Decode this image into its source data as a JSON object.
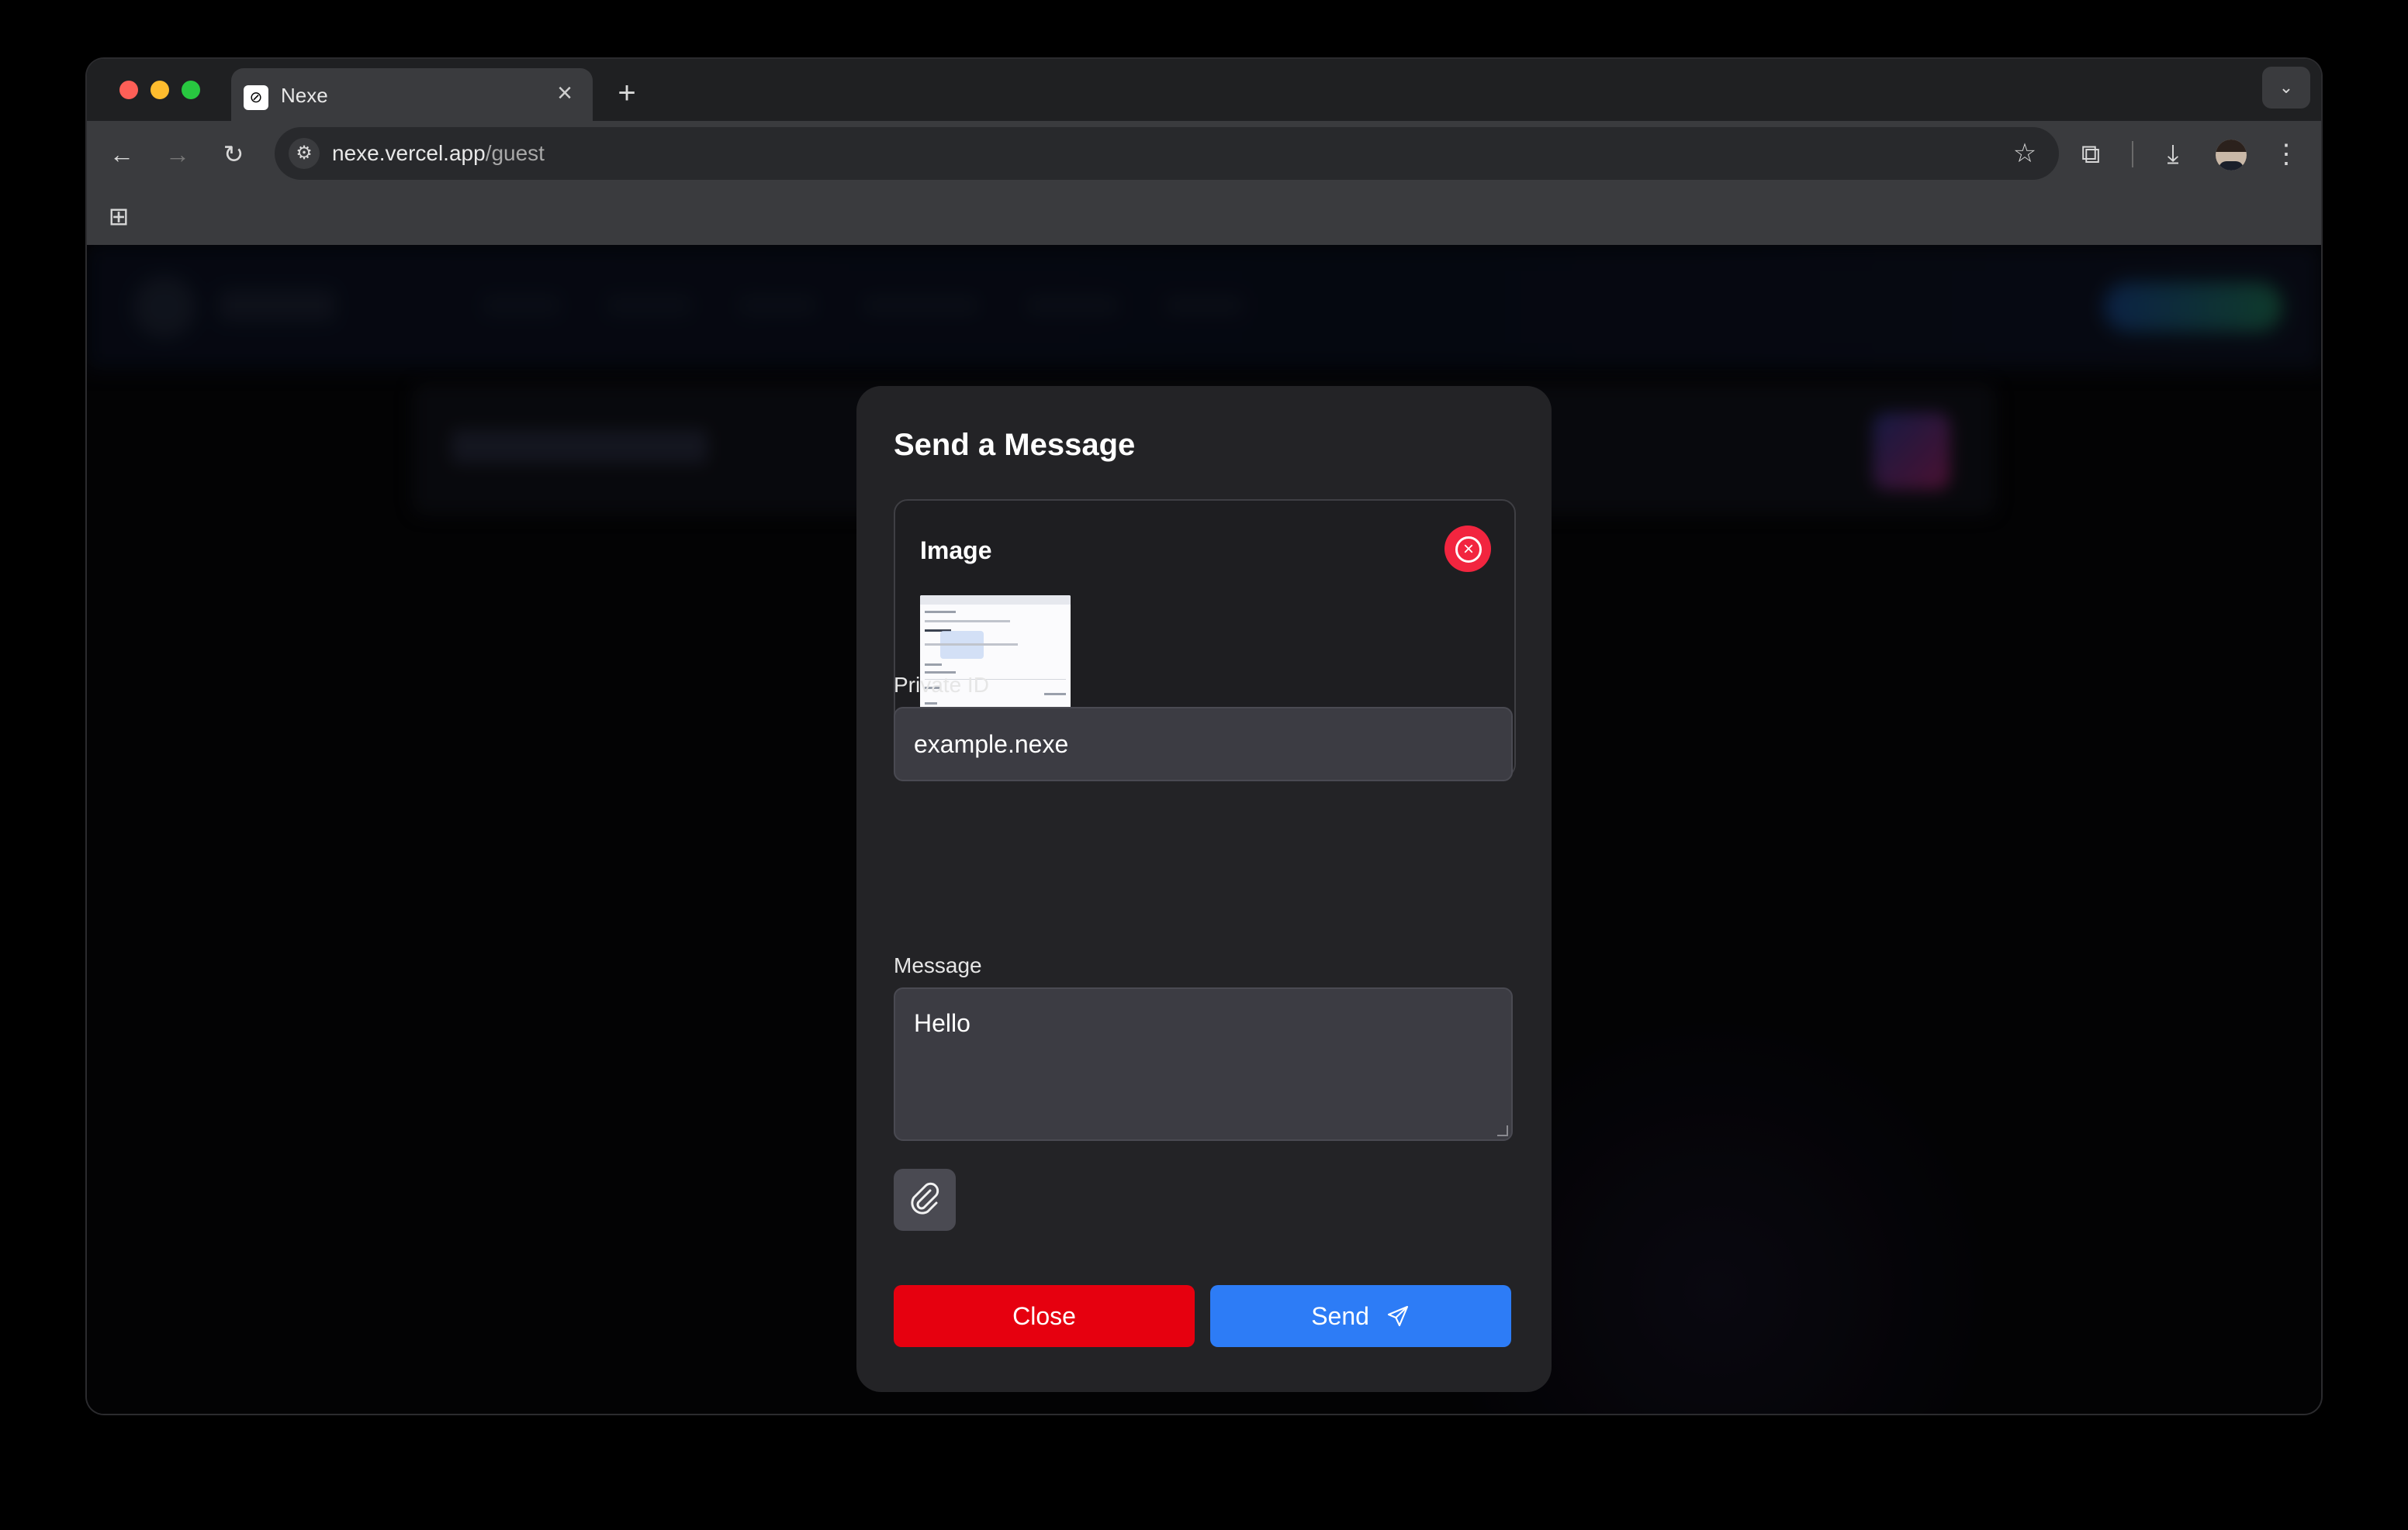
{
  "browser": {
    "tab_title": "Nexe",
    "url_host": "nexe.vercel.app",
    "url_path": "/guest"
  },
  "modal": {
    "title": "Send a Message",
    "image_section_label": "Image",
    "private_id_label": "Private ID",
    "private_id_value": "example.nexe",
    "message_label": "Message",
    "message_value": "Hello",
    "close_label": "Close",
    "send_label": "Send"
  },
  "colors": {
    "close_button": "#e6000f",
    "send_button": "#2d7cf6",
    "remove_image_button": "#f2253f",
    "modal_background": "#232326"
  },
  "icons": {
    "remove_image": "close-circle-icon",
    "attach": "paperclip-icon",
    "send": "paper-plane-icon"
  }
}
